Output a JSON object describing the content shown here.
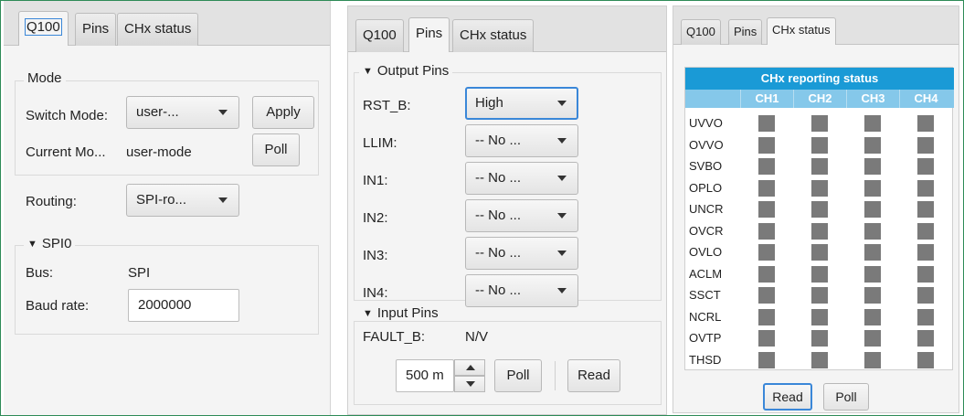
{
  "panel1": {
    "tabs": [
      "Q100",
      "Pins",
      "CHx status"
    ],
    "mode": {
      "legend": "Mode",
      "switch_label": "Switch Mode:",
      "switch_value": "user-...",
      "apply": "Apply",
      "current_label": "Current Mo...",
      "current_value": "user-mode",
      "poll": "Poll"
    },
    "routing": {
      "label": "Routing:",
      "value": "SPI-ro..."
    },
    "spi": {
      "legend": "SPI0",
      "bus_label": "Bus:",
      "bus_value": "SPI",
      "baud_label": "Baud rate:",
      "baud_value": "2000000"
    }
  },
  "panel2": {
    "tabs": [
      "Q100",
      "Pins",
      "CHx status"
    ],
    "output": {
      "legend": "Output Pins",
      "pins": [
        {
          "label": "RST_B:",
          "value": "High"
        },
        {
          "label": "LLIM:",
          "value": "-- No ..."
        },
        {
          "label": "IN1:",
          "value": "-- No ..."
        },
        {
          "label": "IN2:",
          "value": "-- No ..."
        },
        {
          "label": "IN3:",
          "value": "-- No ..."
        },
        {
          "label": "IN4:",
          "value": "-- No ..."
        }
      ]
    },
    "input": {
      "legend": "Input Pins",
      "fault_label": "FAULT_B:",
      "fault_value": "N/V",
      "interval": "500 m",
      "poll": "Poll",
      "read": "Read"
    }
  },
  "panel3": {
    "tabs": [
      "Q100",
      "Pins",
      "CHx status"
    ],
    "title": "CHx reporting status",
    "channels": [
      "CH1",
      "CH2",
      "CH3",
      "CH4"
    ],
    "rows": [
      "UVVO",
      "OVVO",
      "SVBO",
      "OPLO",
      "UNCR",
      "OVCR",
      "OVLO",
      "ACLM",
      "SSCT",
      "NCRL",
      "OVTP",
      "THSD"
    ],
    "indicator_color": "#7a7a7a",
    "read": "Read",
    "poll": "Poll"
  },
  "colors": {
    "accent": "#3a87d8",
    "header_blue": "#1a9ad6",
    "subheader_blue": "#85c8ea",
    "border_green": "#2e8b57"
  }
}
